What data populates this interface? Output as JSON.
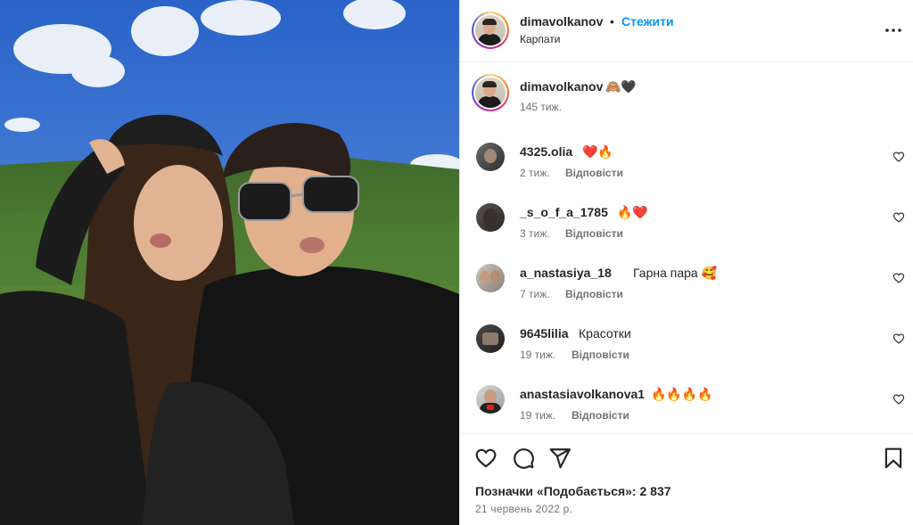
{
  "post": {
    "username": "dimavolkanov",
    "follow_label": "Стежити",
    "dot": "•",
    "location": "Карпати"
  },
  "caption": {
    "username": "dimavolkanov",
    "text": "🙈🖤",
    "time": "145 тиж."
  },
  "comments": [
    {
      "username": "4325.olia",
      "text": "❤️🔥",
      "time": "2 тиж.",
      "reply": "Відповісти"
    },
    {
      "username": "_s_o_f_a_1785",
      "text": "🔥❤️",
      "time": "3 тиж.",
      "reply": "Відповісти"
    },
    {
      "username": "a_nastasiya_18",
      "text": "Гарна пара 🥰",
      "time": "7 тиж.",
      "reply": "Відповісти"
    },
    {
      "username": "9645lilia",
      "text": "Красотки",
      "time": "19 тиж.",
      "reply": "Відповісти"
    },
    {
      "username": "anastasiavolkanova1",
      "text": "🔥🔥🔥🔥",
      "time": "19 тиж.",
      "reply": "Відповісти"
    }
  ],
  "footer": {
    "likes": "Позначки «Подобається»: 2 837",
    "date": "21 червень 2022 р."
  },
  "icons": {
    "more": "more-options-icon",
    "like": "heart-icon",
    "comment": "comment-icon",
    "share": "paper-plane-icon",
    "save": "bookmark-icon"
  },
  "colors": {
    "accent": "#0095f6",
    "secondary_text": "#737373",
    "border": "#efefef"
  }
}
